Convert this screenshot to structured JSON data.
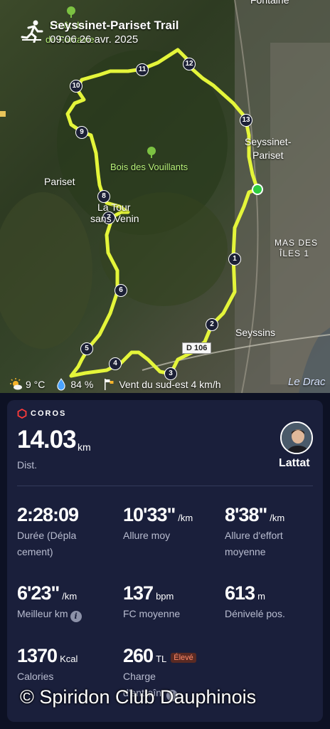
{
  "map": {
    "title": "Seyssinet-Pariset Trail",
    "date": "09:06 26 avr. 2025",
    "places": {
      "foret": "Forêt de",
      "fontaine_top": "Fontaine",
      "fontaine_left": "de Fontaine",
      "pariset": "Pariset",
      "bois": "Bois des Vouillants",
      "seyssinet_1": "Seyssinet-",
      "seyssinet_2": "Pariset",
      "la_tour_1": "La Tour",
      "la_tour_2": "sans Venin",
      "mas_1": "MAS DES",
      "mas_2": "ÎLES 1",
      "seyssins": "Seyssins",
      "le_drac": "Le Drac"
    },
    "road": "D 106",
    "markers": [
      "1",
      "2",
      "3",
      "4",
      "5",
      "6",
      "7",
      "8",
      "9",
      "10",
      "11",
      "12",
      "13"
    ],
    "route_color": "#e4f53a",
    "start_color": "#2ecc40"
  },
  "weather": {
    "temp": "9 °C",
    "humidity": "84  %",
    "wind": "Vent du sud-est 4 km/h"
  },
  "card": {
    "brand": "COROS",
    "distance": {
      "value": "14.03",
      "unit": "km",
      "label": "Dist."
    },
    "user": {
      "name": "Lattat"
    },
    "stats": [
      {
        "value": "2:28:09",
        "unit": "",
        "label_1": "Durée (Dépla",
        "label_2": "cement)"
      },
      {
        "value": "10'33\"",
        "unit": "/km",
        "label_1": "Allure moy",
        "label_2": ""
      },
      {
        "value": "8'38\"",
        "unit": "/km",
        "label_1": "Allure d'effort",
        "label_2": "moyenne"
      },
      {
        "value": "6'23\"",
        "unit": "/km",
        "label_1": "Meilleur km",
        "label_2": ""
      },
      {
        "value": "137",
        "unit": "bpm",
        "label_1": "FC moyenne",
        "label_2": ""
      },
      {
        "value": "613",
        "unit": "m",
        "label_1": "Dénivelé pos.",
        "label_2": ""
      },
      {
        "value": "1370",
        "unit": "Kcal",
        "label_1": "Calories",
        "label_2": ""
      },
      {
        "value": "260",
        "unit": "TL",
        "label_1": "Charge",
        "label_2": "d'entraîn.",
        "badge": "Élevé"
      }
    ]
  },
  "watermark": "© Spiridon Club Dauphinois"
}
